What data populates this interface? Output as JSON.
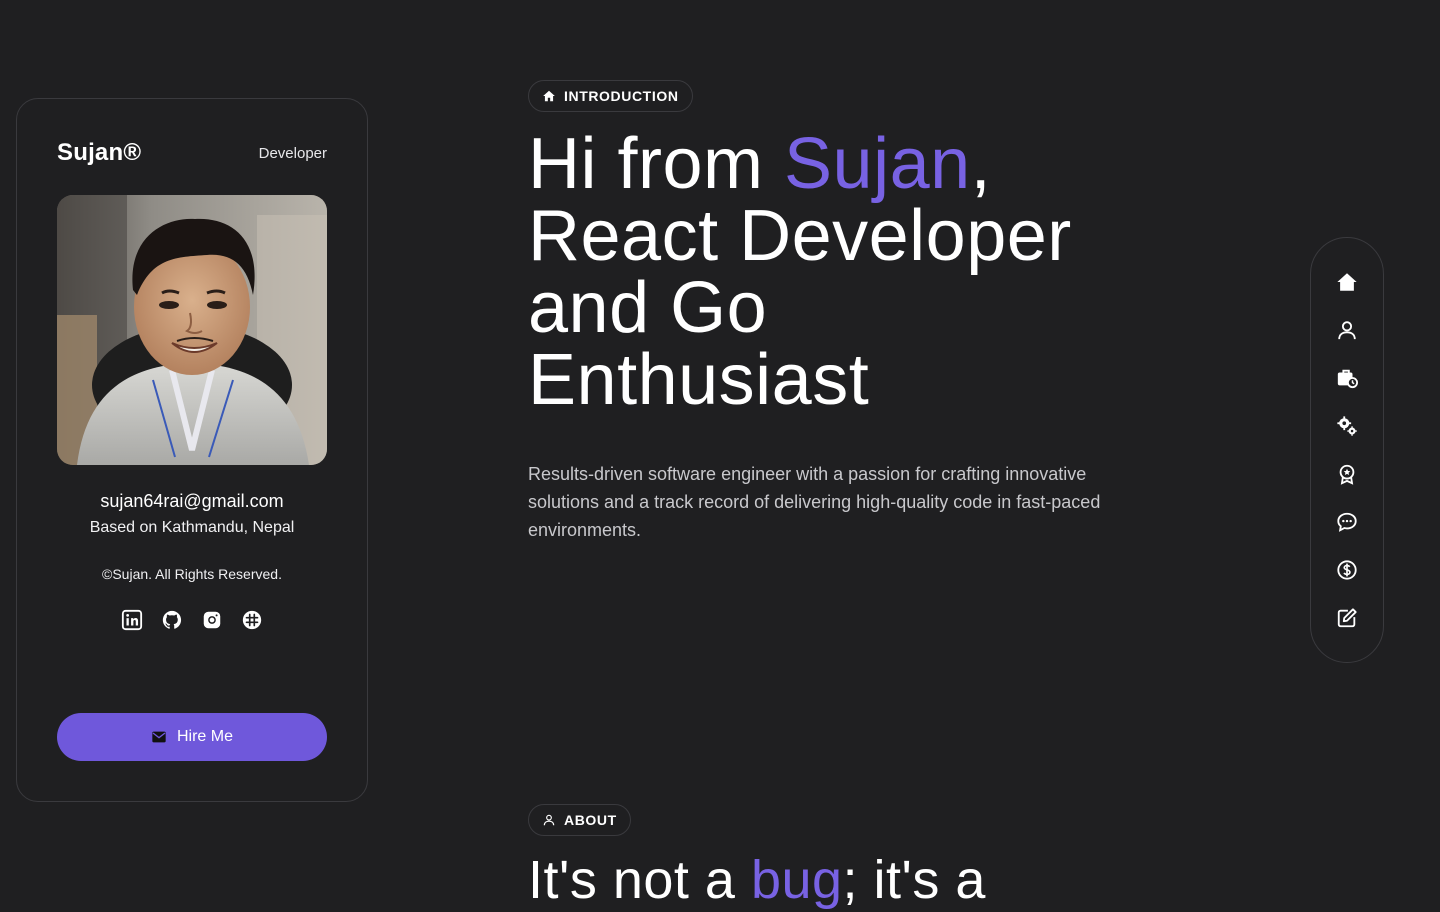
{
  "profile": {
    "brand": "Sujan®",
    "role": "Developer",
    "email": "sujan64rai@gmail.com",
    "location": "Based on Kathmandu, Nepal",
    "copyright": "©Sujan. All Rights Reserved.",
    "socials": [
      "linkedin-icon",
      "github-icon",
      "instagram-icon",
      "slack-icon"
    ],
    "hire_label": "Hire Me"
  },
  "intro": {
    "tag": "INTRODUCTION",
    "hero": {
      "part1": "Hi from ",
      "name": "Sujan",
      "part2": ",",
      "line2": "React Developer",
      "line3": "and Go",
      "line4": "Enthusiast"
    },
    "description": "Results-driven software engineer with a passion for crafting innovative solutions and a track record of delivering high-quality code in fast-paced environments."
  },
  "about": {
    "tag": "ABOUT",
    "heading_part1": "It's not a ",
    "heading_accent": "bug",
    "heading_part2": "; it's a"
  },
  "sidenav": {
    "items": [
      "home-icon",
      "user-icon",
      "briefcase-clock-icon",
      "gears-icon",
      "award-icon",
      "chat-icon",
      "dollar-icon",
      "edit-icon"
    ]
  },
  "colors": {
    "background": "#1f1f21",
    "accent": "#7862e3",
    "button": "#6f58db",
    "border": "#3a3a3e",
    "muted_text": "#c8c8cc"
  }
}
